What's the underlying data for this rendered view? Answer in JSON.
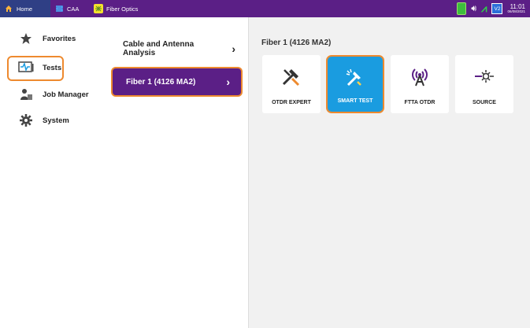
{
  "topbar": {
    "tabs": [
      {
        "label": "Home",
        "icon": "home-icon"
      },
      {
        "label": "CAA",
        "icon": "caa-icon"
      },
      {
        "label": "Fiber Optics",
        "icon": "fiber-optics-icon"
      }
    ],
    "status": {
      "v2": "V2",
      "time": "11:01",
      "date": "06/08/2021"
    }
  },
  "sidebar": {
    "items": [
      {
        "label": "Favorites",
        "icon": "star-icon"
      },
      {
        "label": "Tests",
        "icon": "tests-icon"
      },
      {
        "label": "Job Manager",
        "icon": "job-manager-icon"
      },
      {
        "label": "System",
        "icon": "gear-icon"
      }
    ]
  },
  "middle": {
    "items": [
      {
        "label": "Cable and Antenna Analysis"
      },
      {
        "label": "Fiber 1 (4126 MA2)"
      }
    ]
  },
  "main": {
    "title": "Fiber 1 (4126 MA2)",
    "tiles": [
      {
        "label": "OTDR EXPERT",
        "icon": "otdr-expert-icon"
      },
      {
        "label": "SMART TEST",
        "icon": "smart-test-icon"
      },
      {
        "label": "FTTA OTDR",
        "icon": "ftta-otdr-icon"
      },
      {
        "label": "SOURCE",
        "icon": "source-icon"
      }
    ]
  },
  "colors": {
    "topbar": "#5b1f86",
    "home_tab": "#2f3f85",
    "selected": "#5b1f86",
    "highlight": "#ee8a2f",
    "smart_tile": "#1a9ce0"
  }
}
